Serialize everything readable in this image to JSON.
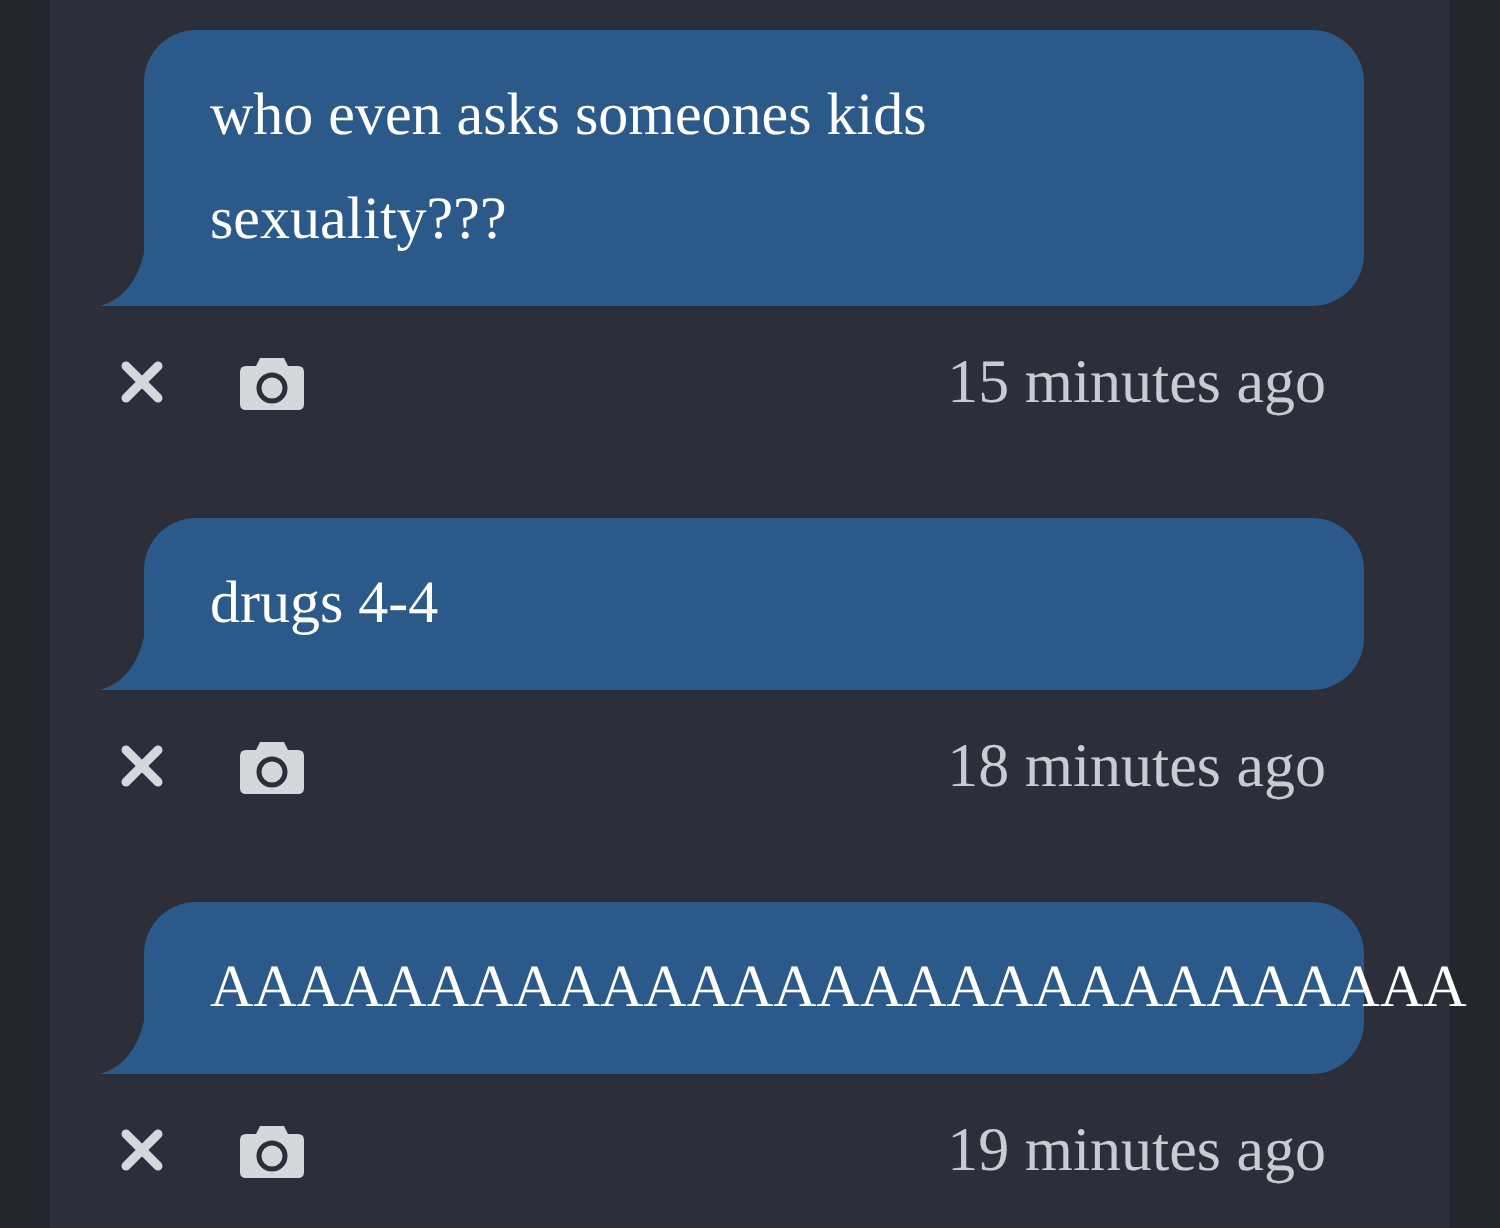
{
  "messages": [
    {
      "text": "who even asks someones kids sexuality???",
      "time": "15 minutes ago"
    },
    {
      "text": "drugs 4-4",
      "time": "18 minutes ago"
    },
    {
      "text": "AAAAAAAAAAAAAAAAAAAAAAAAAAAAA",
      "time": "19 minutes ago"
    }
  ]
}
